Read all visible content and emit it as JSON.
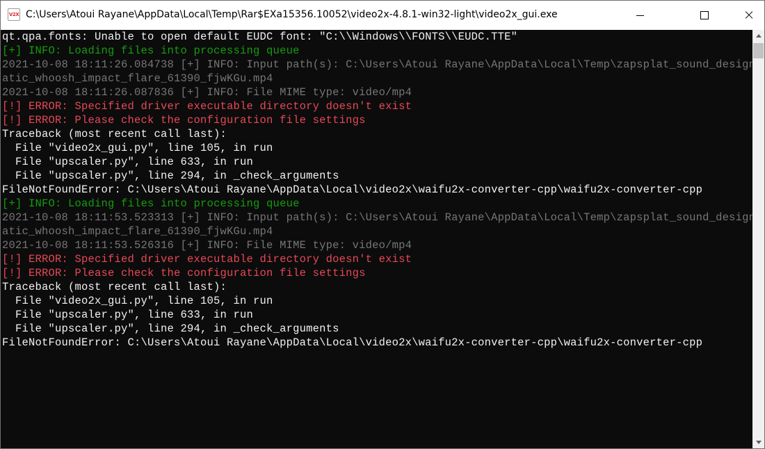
{
  "window": {
    "title": "C:\\Users\\Atoui Rayane\\AppData\\Local\\Temp\\Rar$EXa15356.10052\\video2x-4.8.1-win32-light\\video2x_gui.exe",
    "icon_text": "V2X",
    "icon_name": "video2x-app-icon",
    "controls": {
      "minimize_icon": "minimize-icon",
      "maximize_icon": "maximize-icon",
      "close_icon": "close-icon"
    }
  },
  "colors": {
    "console_bg": "#0c0c0c",
    "default_text": "#cccccc",
    "info_text": "#16c60c",
    "debug_text": "#767676",
    "error_text": "#e74856"
  },
  "console": {
    "lines": [
      {
        "kind": "white",
        "text": "qt.qpa.fonts: Unable to open default EUDC font: \"C:\\\\Windows\\\\FONTS\\\\EUDC.TTE\""
      },
      {
        "kind": "info",
        "text": "[+] INFO: Loading files into processing queue"
      },
      {
        "kind": "debug",
        "text": "2021-10-08 18:11:26.084738 [+] INFO: Input path(s): C:\\Users\\Atoui Rayane\\AppData\\Local\\Temp\\zapsplat_sound_design_cinem"
      },
      {
        "kind": "debug",
        "text": "atic_whoosh_impact_flare_61390_fjwKGu.mp4"
      },
      {
        "kind": "debug",
        "text": "2021-10-08 18:11:26.087836 [+] INFO: File MIME type: video/mp4"
      },
      {
        "kind": "error",
        "text": "[!] ERROR: Specified driver executable directory doesn't exist"
      },
      {
        "kind": "error",
        "text": "[!] ERROR: Please check the configuration file settings"
      },
      {
        "kind": "white",
        "text": "Traceback (most recent call last):"
      },
      {
        "kind": "white",
        "text": "  File \"video2x_gui.py\", line 105, in run"
      },
      {
        "kind": "white",
        "text": "  File \"upscaler.py\", line 633, in run"
      },
      {
        "kind": "white",
        "text": "  File \"upscaler.py\", line 294, in _check_arguments"
      },
      {
        "kind": "white",
        "text": "FileNotFoundError: C:\\Users\\Atoui Rayane\\AppData\\Local\\video2x\\waifu2x-converter-cpp\\waifu2x-converter-cpp"
      },
      {
        "kind": "info",
        "text": "[+] INFO: Loading files into processing queue"
      },
      {
        "kind": "debug",
        "text": "2021-10-08 18:11:53.523313 [+] INFO: Input path(s): C:\\Users\\Atoui Rayane\\AppData\\Local\\Temp\\zapsplat_sound_design_cinem"
      },
      {
        "kind": "debug",
        "text": "atic_whoosh_impact_flare_61390_fjwKGu.mp4"
      },
      {
        "kind": "debug",
        "text": "2021-10-08 18:11:53.526316 [+] INFO: File MIME type: video/mp4"
      },
      {
        "kind": "error",
        "text": "[!] ERROR: Specified driver executable directory doesn't exist"
      },
      {
        "kind": "error",
        "text": "[!] ERROR: Please check the configuration file settings"
      },
      {
        "kind": "white",
        "text": "Traceback (most recent call last):"
      },
      {
        "kind": "white",
        "text": "  File \"video2x_gui.py\", line 105, in run"
      },
      {
        "kind": "white",
        "text": "  File \"upscaler.py\", line 633, in run"
      },
      {
        "kind": "white",
        "text": "  File \"upscaler.py\", line 294, in _check_arguments"
      },
      {
        "kind": "white",
        "text": "FileNotFoundError: C:\\Users\\Atoui Rayane\\AppData\\Local\\video2x\\waifu2x-converter-cpp\\waifu2x-converter-cpp"
      }
    ]
  },
  "scrollbar": {
    "up_icon": "scroll-up-arrow-icon",
    "down_icon": "scroll-down-arrow-icon",
    "position": 0
  }
}
